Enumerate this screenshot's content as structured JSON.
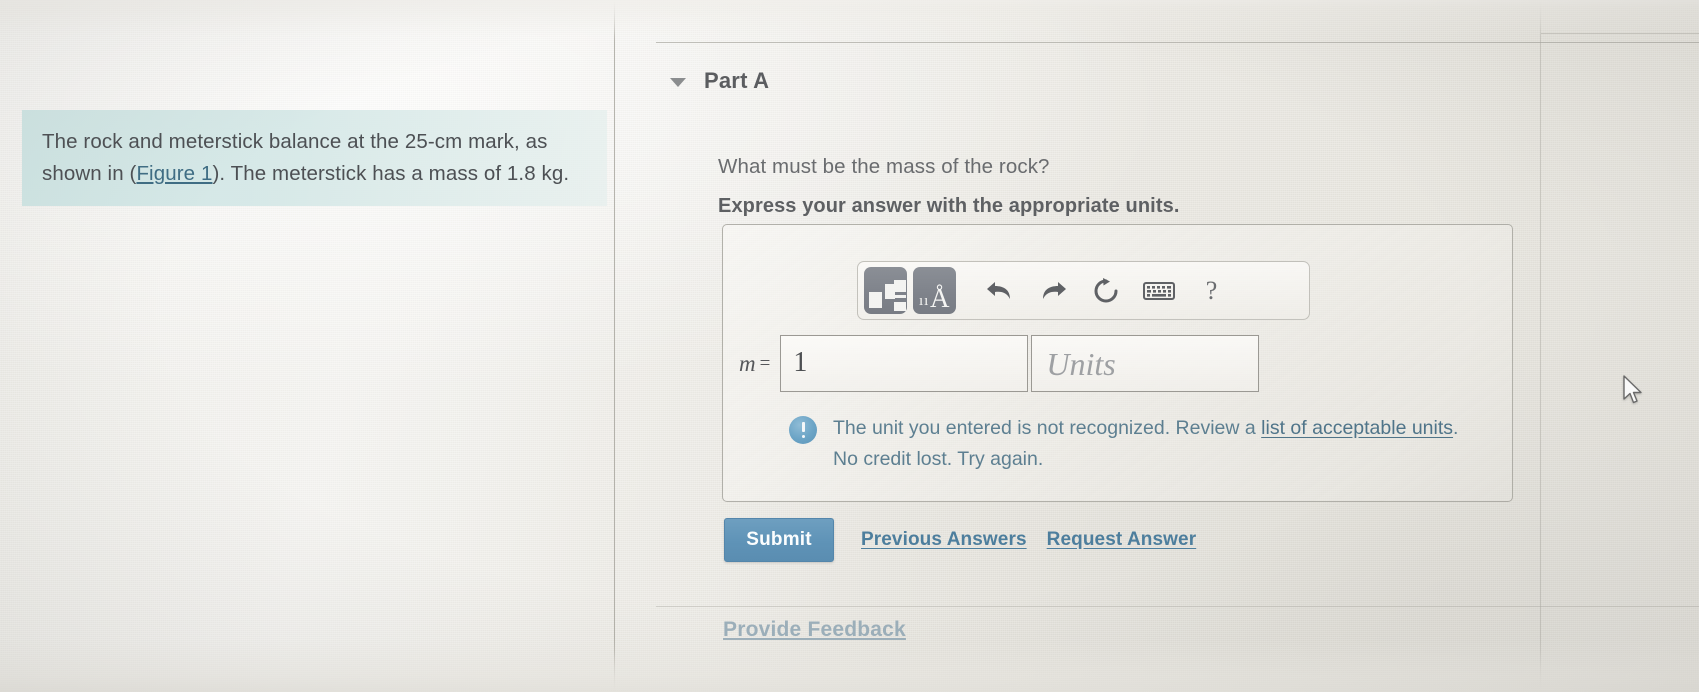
{
  "problem": {
    "text_before_link": "The rock and meterstick balance at the 25-cm mark, as shown in (",
    "figure_link": "Figure 1",
    "text_after_link": "). The meterstick has a mass of 1.8 kg."
  },
  "part": {
    "title": "Part A",
    "collapse_icon": "caret-down-icon",
    "question": "What must be the mass of the rock?",
    "instruction": "Express your answer with the appropriate units."
  },
  "toolbar": {
    "template_button": "math-template-icon",
    "units_button": "units-icon",
    "units_button_glyph": "Å",
    "units_button_bars": "ıı",
    "undo_button": "undo-arrow-icon",
    "redo_button": "redo-arrow-icon",
    "reset_button": "reset-circular-arrow-icon",
    "keyboard_button": "keyboard-icon",
    "help_button": "?"
  },
  "answer": {
    "variable_label": "m",
    "equals": "=",
    "value": "1",
    "units_placeholder": "Units"
  },
  "feedback": {
    "icon": "info-exclamation-icon",
    "line1_before_link": "The unit you entered is not recognized. Review a ",
    "link_text": "list of acceptable units",
    "line1_after_link": ".",
    "line2": "No credit lost. Try again."
  },
  "actions": {
    "submit_label": "Submit",
    "previous_answers_label": "Previous Answers",
    "request_answer_label": "Request Answer"
  },
  "footer": {
    "provide_feedback_label": "Provide Feedback"
  },
  "colors": {
    "submit_blue": "#5f93b7",
    "link_blue": "#4d7e9d",
    "info_blue": "#6ba4c6",
    "highlight_teal": "#cde5e4",
    "body_gray": "#6a6c6f"
  }
}
